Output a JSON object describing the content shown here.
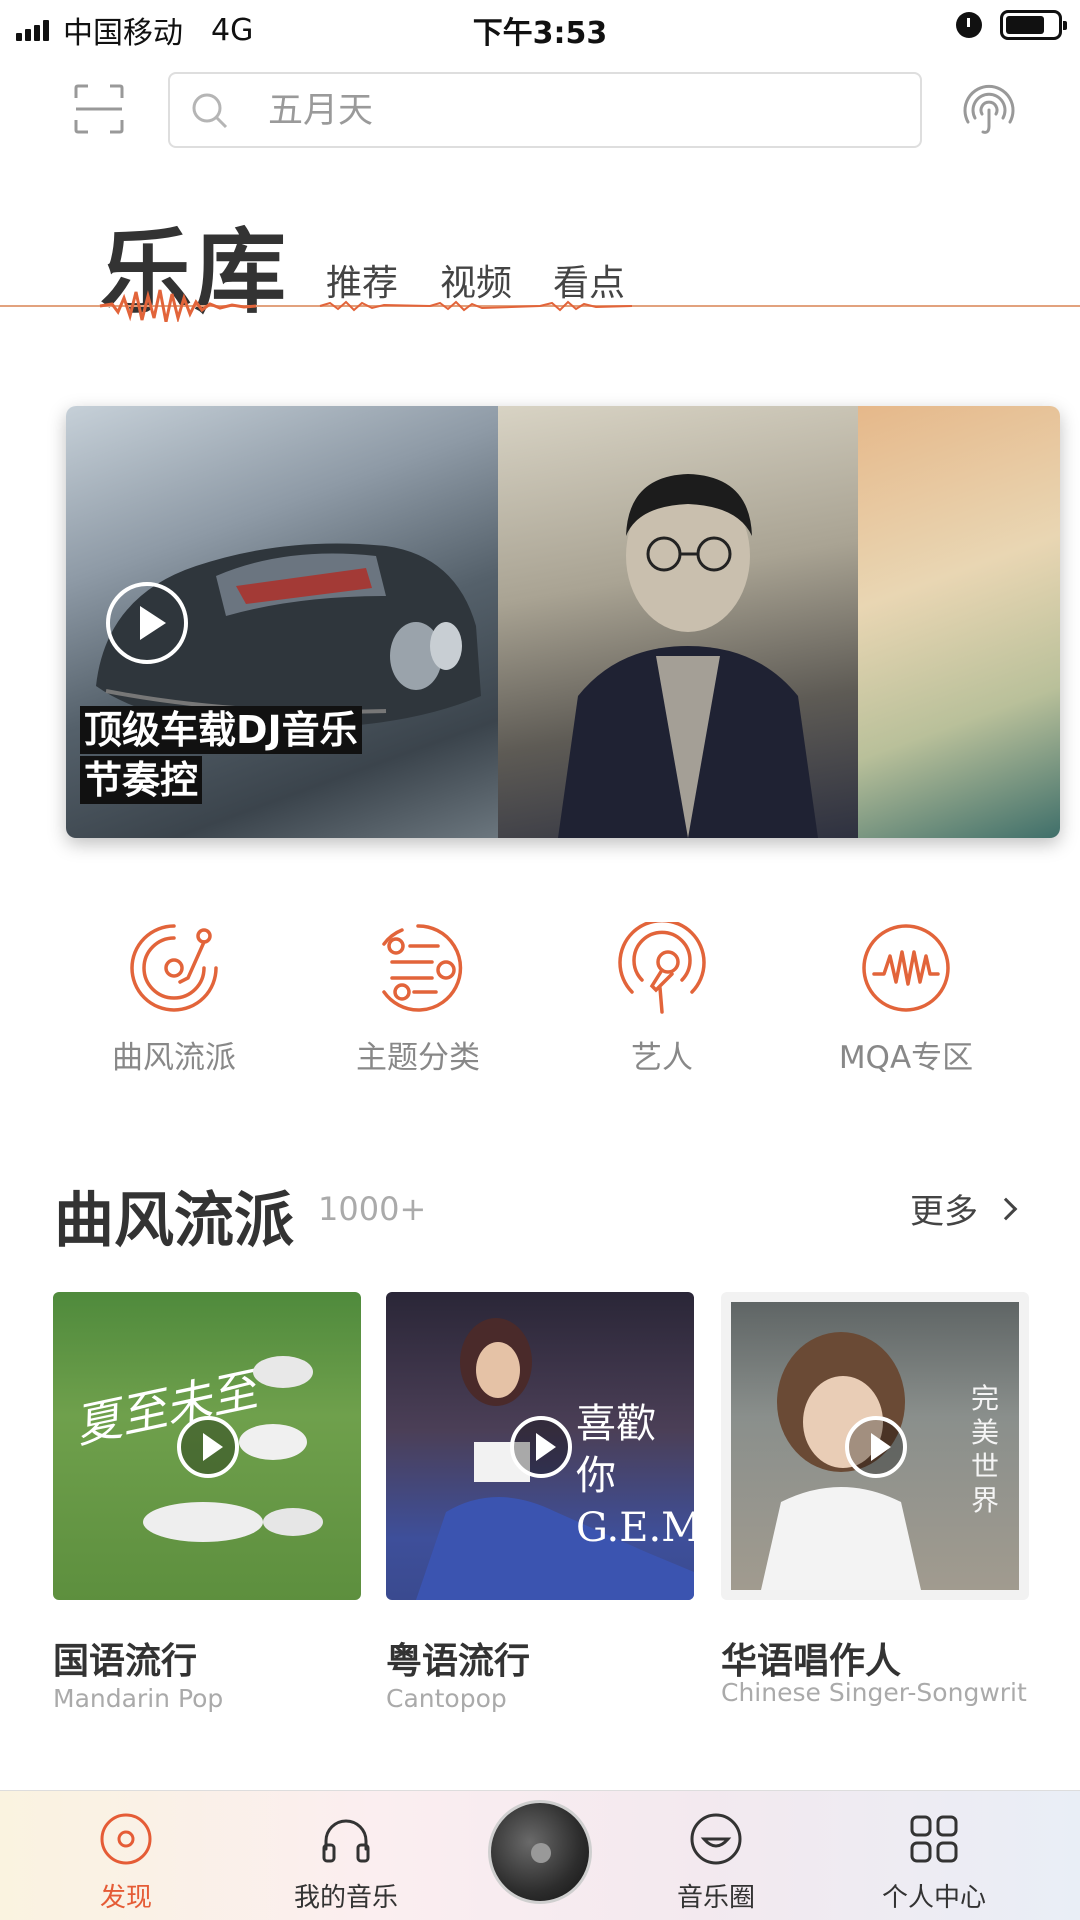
{
  "status_bar": {
    "carrier": "中国移动",
    "network": "4G",
    "time": "下午3:53",
    "battery_level": 0.75
  },
  "search": {
    "placeholder": "五月天"
  },
  "header": {
    "title": "乐库",
    "tabs": [
      "推荐",
      "视频",
      "看点"
    ],
    "accent_color": "#e2643a"
  },
  "banner": {
    "caption_line1": "顶级车载DJ音乐",
    "caption_line2": "节奏控"
  },
  "categories": [
    {
      "label": "曲风流派",
      "icon": "vinyl-record-icon"
    },
    {
      "label": "主题分类",
      "icon": "topic-list-icon"
    },
    {
      "label": "艺人",
      "icon": "microphone-icon"
    },
    {
      "label": "MQA专区",
      "icon": "waveform-icon"
    }
  ],
  "section": {
    "title": "曲风流派",
    "count": "1000+",
    "more_label": "更多",
    "albums": [
      {
        "title": "国语流行",
        "subtitle": "Mandarin Pop",
        "art_text": "夏至未至"
      },
      {
        "title": "粤语流行",
        "subtitle": "Cantopop",
        "art_text": "喜歡你 G.E.M."
      },
      {
        "title": "华语唱作人",
        "subtitle": "Chinese Singer-Songwrit",
        "art_text": "完美世界"
      }
    ]
  },
  "tab_bar": {
    "items": [
      "发现",
      "我的音乐",
      "音乐圈",
      "个人中心"
    ],
    "active_color": "#e55c36"
  }
}
